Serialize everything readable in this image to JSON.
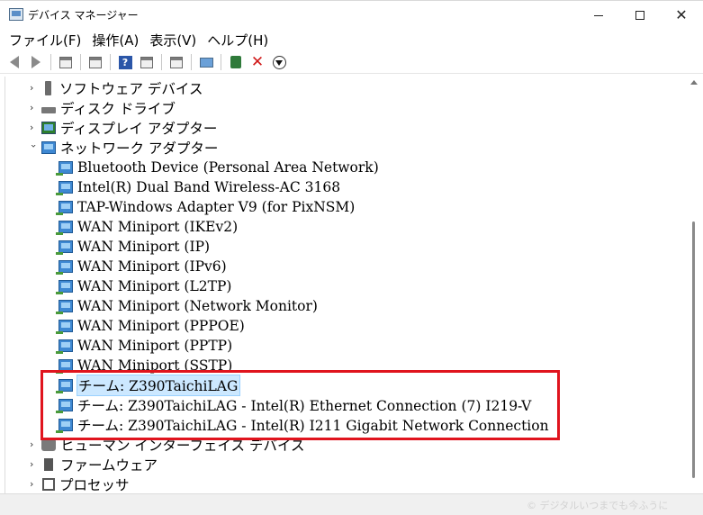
{
  "window": {
    "title": "デバイス マネージャー",
    "app_icon": "device-manager-icon",
    "controls": {
      "minimize": "minimize-icon",
      "maximize": "maximize-icon",
      "close": "close-icon"
    }
  },
  "menu": [
    "ファイル(F)",
    "操作(A)",
    "表示(V)",
    "ヘルプ(H)"
  ],
  "toolbar": {
    "buttons": [
      "back-arrow-icon",
      "forward-arrow-icon",
      "console-tree-icon",
      "properties-icon",
      "help-icon",
      "view-icon",
      "scan-hardware-icon",
      "monitor-icon",
      "update-driver-icon",
      "uninstall-x-icon",
      "download-icon"
    ]
  },
  "tree": {
    "categories_before": [
      {
        "label": "ソフトウェア デバイス",
        "expanded": false,
        "icon": "software-device-icon"
      },
      {
        "label": "ディスク ドライブ",
        "expanded": false,
        "icon": "disk-drive-icon"
      },
      {
        "label": "ディスプレイ アダプター",
        "expanded": false,
        "icon": "display-adapter-icon"
      }
    ],
    "network_category": {
      "label": "ネットワーク アダプター",
      "expanded": true,
      "icon": "network-adapter-icon"
    },
    "network_children": [
      "Bluetooth Device (Personal Area Network)",
      "Intel(R) Dual Band Wireless-AC 3168",
      "TAP-Windows Adapter V9 (for PixNSM)",
      "WAN Miniport (IKEv2)",
      "WAN Miniport (IP)",
      "WAN Miniport (IPv6)",
      "WAN Miniport (L2TP)",
      "WAN Miniport (Network Monitor)",
      "WAN Miniport (PPPOE)",
      "WAN Miniport (PPTP)",
      "WAN Miniport (SSTP)",
      "チーム: Z390TaichiLAG",
      "チーム: Z390TaichiLAG - Intel(R) Ethernet Connection (7) I219-V",
      "チーム: Z390TaichiLAG - Intel(R) I211 Gigabit Network Connection"
    ],
    "selected_child": "チーム: Z390TaichiLAG",
    "categories_after": [
      {
        "label": "ヒューマン インターフェイス デバイス",
        "expanded": false,
        "icon": "hid-icon"
      },
      {
        "label": "ファームウェア",
        "expanded": false,
        "icon": "firmware-icon"
      },
      {
        "label": "プロセッサ",
        "expanded": false,
        "icon": "processor-icon"
      }
    ]
  },
  "highlight_color": "#e0141e",
  "status": {
    "watermark": "© デジタルいつまでも今ふうに"
  }
}
